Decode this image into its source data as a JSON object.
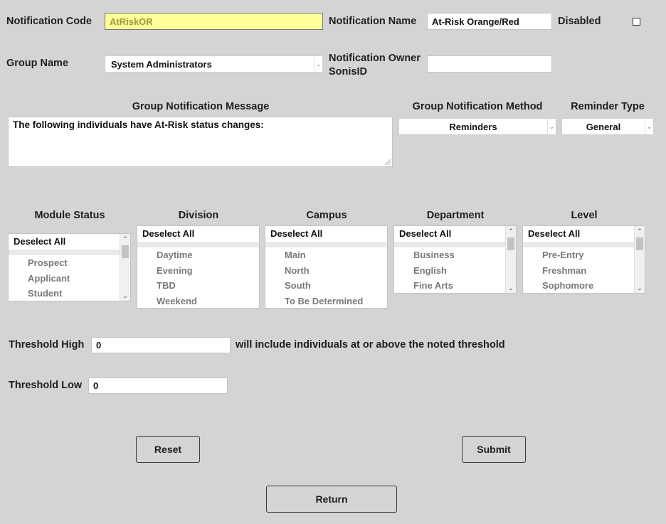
{
  "notification": {
    "code_label": "Notification Code",
    "code_value": "AtRiskOR",
    "name_label": "Notification Name",
    "name_value": "At-Risk Orange/Red",
    "disabled_label": "Disabled"
  },
  "group": {
    "name_label": "Group Name",
    "name_value": "System Administrators",
    "owner_label_line1": "Notification Owner",
    "owner_label_line2": "SonisID",
    "owner_value": ""
  },
  "message": {
    "header": "Group Notification Message",
    "value": "The following individuals have At-Risk status changes:"
  },
  "method": {
    "header": "Group Notification Method",
    "value": "Reminders"
  },
  "reminder": {
    "header": "Reminder Type",
    "value": "General"
  },
  "filters": {
    "module_status": {
      "header": "Module Status",
      "first": "Deselect All",
      "options": [
        "Prospect",
        "Applicant",
        "Student"
      ]
    },
    "division": {
      "header": "Division",
      "first": "Deselect All",
      "options": [
        "Daytime",
        "Evening",
        "TBD",
        "Weekend"
      ]
    },
    "campus": {
      "header": "Campus",
      "first": "Deselect All",
      "options": [
        "Main",
        "North",
        "South",
        "To Be Determined"
      ]
    },
    "department": {
      "header": "Department",
      "first": "Deselect All",
      "options": [
        "Business",
        "English",
        "Fine Arts"
      ]
    },
    "level": {
      "header": "Level",
      "first": "Deselect All",
      "options": [
        "Pre-Entry",
        "Freshman",
        "Sophomore"
      ]
    }
  },
  "threshold": {
    "high_label": "Threshold High",
    "high_value": "0",
    "high_note": "will include individuals at or above the noted threshold",
    "low_label": "Threshold Low",
    "low_value": "0"
  },
  "buttons": {
    "reset": "Reset",
    "submit": "Submit",
    "return": "Return"
  },
  "icons": {
    "dropdown": "chevron-down-icon",
    "scroll_up": "arrow-up-icon",
    "scroll_down": "arrow-down-icon",
    "checkbox": "checkbox-icon"
  },
  "colors": {
    "background": "#d4d4d4",
    "highlight_field": "#ffff99"
  }
}
